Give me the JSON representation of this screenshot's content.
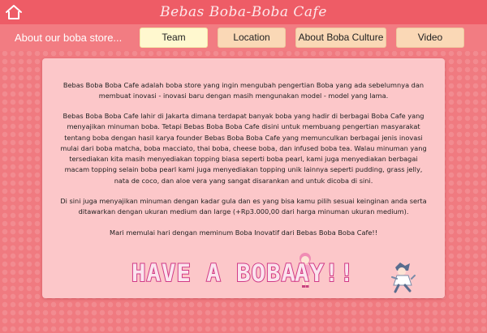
{
  "header": {
    "title": "Bebas Boba-Boba Cafe",
    "home_icon": "home-icon"
  },
  "nav": {
    "about": "About our boba store...",
    "buttons": [
      "Team",
      "Location",
      "About Boba Culture",
      "Video"
    ]
  },
  "content": {
    "paragraphs": [
      "Bebas Boba Boba Cafe adalah boba store yang ingin mengubah pengertian Boba yang ada sebelumnya dan membuat inovasi - inovasi baru dengan masih mengunakan model - model yang lama.",
      "Bebas Boba Boba Cafe lahir di Jakarta dimana terdapat banyak boba yang hadir di berbagai Boba Cafe yang menyajikan minuman boba. Tetapi Bebas Boba Boba Cafe disini untuk membuang pengertian masyarakat tentang boba dengan hasil karya founder Bebas Boba Boba Cafe yang memunculkan berbagai jenis inovasi mulai dari boba matcha, boba macciato, thai boba, cheese boba, dan infused boba tea. Walau minuman yang tersediakan kita masih menyediakan topping biasa seperti boba pearl, kami juga menyediakan berbagai macam topping selain boba pearl kami juga menyediakan topping unik lainnya seperti pudding, grass jelly, nata de coco, dan aloe vera yang sangat disarankan and untuk dicoba di sini.",
      "Di sini juga menyajikan minuman dengan kadar gula dan es yang bisa kamu pilih sesuai keinginan anda serta ditawarkan dengan ukuran medium dan large (+Rp3.000,00 dari harga minuman ukuran medium).",
      "Mari memulai hari dengan meminum Boba Inovatif dari Bebas Boba Boba Cafe!!"
    ],
    "banner_start": "HAVE A BOBA ",
    "banner_end": "AY!!"
  },
  "colors": {
    "background": "#f07a80",
    "titlebar": "#ee5c66",
    "navbar": "#f27c82",
    "panel": "#fcc7c9",
    "active_button": "#fff8cf",
    "button": "#fad8b6",
    "banner_outline": "#d13a86"
  }
}
